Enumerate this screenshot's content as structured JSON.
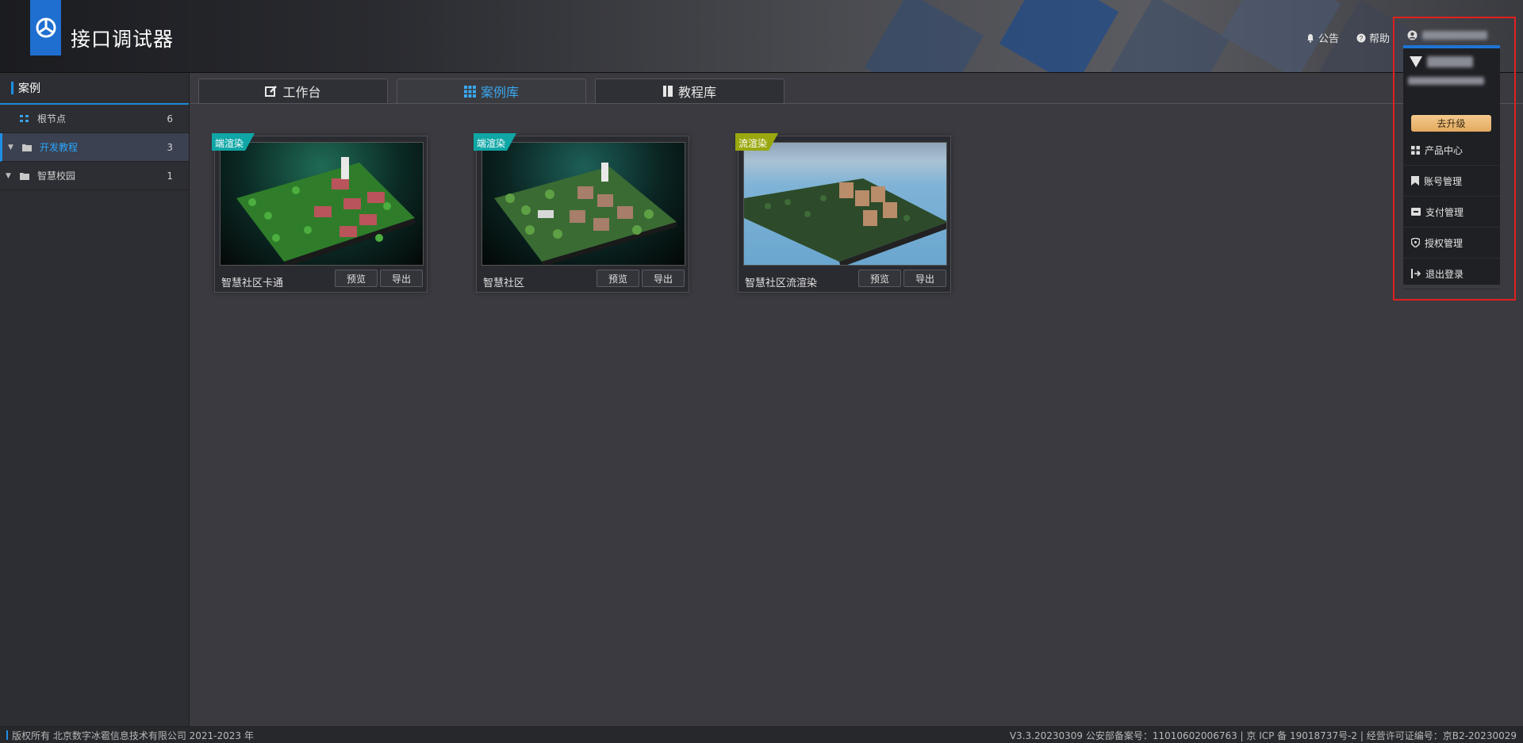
{
  "header": {
    "app_title": "接口调试器",
    "notice_label": "公告",
    "help_label": "帮助"
  },
  "sidebar": {
    "title": "案例",
    "items": [
      {
        "label": "根节点",
        "count": "6"
      },
      {
        "label": "开发教程",
        "count": "3"
      },
      {
        "label": "智慧校园",
        "count": "1"
      }
    ]
  },
  "tabs": [
    {
      "label": "工作台"
    },
    {
      "label": "案例库"
    },
    {
      "label": "教程库"
    }
  ],
  "cards": [
    {
      "badge": "端渲染",
      "title": "智慧社区卡通",
      "preview": "预览",
      "export": "导出",
      "badge_color": "#10a6a6"
    },
    {
      "badge": "端渲染",
      "title": "智慧社区",
      "preview": "预览",
      "export": "导出",
      "badge_color": "#10a6a6"
    },
    {
      "badge": "流渲染",
      "title": "智慧社区流渲染",
      "preview": "预览",
      "export": "导出",
      "badge_color": "#9aa80f"
    }
  ],
  "dropdown": {
    "upgrade_label": "去升级",
    "items": [
      {
        "label": "产品中心",
        "icon": "grid-icon"
      },
      {
        "label": "账号管理",
        "icon": "bookmark-icon"
      },
      {
        "label": "支付管理",
        "icon": "payment-icon"
      },
      {
        "label": "授权管理",
        "icon": "shield-icon"
      },
      {
        "label": "退出登录",
        "icon": "logout-icon"
      }
    ]
  },
  "footer": {
    "copyright": "版权所有 北京数字冰雹信息技术有限公司 2021-2023 年",
    "info": "V3.3.20230309 公安部备案号：11010602006763 | 京 ICP 备 19018737号-2 | 经营许可证编号：京B2-20230029"
  },
  "colors": {
    "accent": "#1e8fe6",
    "active_tab_text": "#3aa8f0",
    "highlight": "#e02020",
    "upgrade": "#e8b36b"
  }
}
